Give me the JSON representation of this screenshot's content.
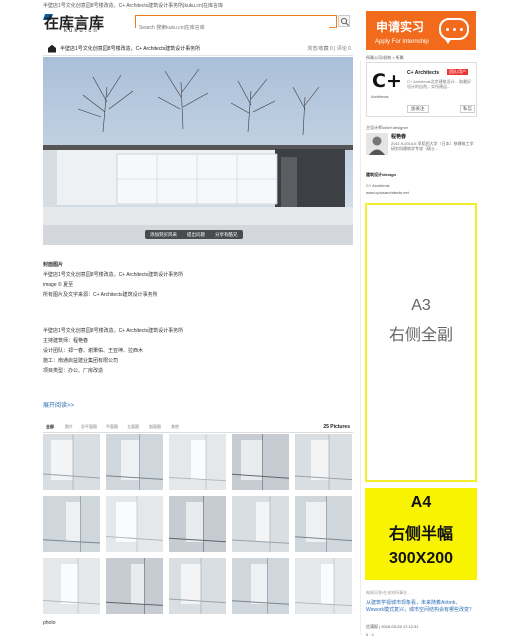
{
  "header": {
    "topline": "半壁店1号文化创意园8号楼改造，C+ Architects建筑设计事务所|kuku.cn|在库言库",
    "logo_main": "在库言库",
    "logo_sub": "kuku.cn",
    "search_placeholder": "Search 搜索kuku.cn|在库言库"
  },
  "apply": {
    "zh": "申请实习",
    "en": "Apply For Internship"
  },
  "article": {
    "title": "半壁店1号文化创意园8号楼改造，C+ Architects建筑设计事务所",
    "stats": "浏览/收藏 0 | 评论 0",
    "hero_buttons": [
      "添加到买风采",
      "提出问题",
      "分享有酷兄"
    ],
    "cover_label": "封面图片",
    "cover_lines": [
      "半壁店1号文化创意园8号楼改造，C+ Architects建筑设计事务所",
      "image © 夏至",
      "所有图片及文字来源：C+ Architects建筑设计事务所"
    ],
    "info_lines": [
      "半壁店1号文化创意园8号楼改造，C+ Architects建筑设计事务所",
      "主持建筑师：程艳春",
      "设计团队：郑一春、谢秉佑、王亚坤、拉西木",
      "施工：南通启益建业集团有限公司",
      "项目类型：办公、厂房改造"
    ],
    "more_link": "展开阅读>>",
    "tabs": [
      "全部",
      "照片",
      "总平面图",
      "平面图",
      "立面图",
      "剖面图",
      "其他"
    ],
    "pictures_count": "25 Pictures",
    "photo_caption": "photo"
  },
  "sidebar": {
    "breadcrumb": "所属公司/机构 > 所属",
    "company_name": "C+ Architects",
    "company_badge": "团队/用户",
    "company_logo_text": "C+",
    "company_logo_sub": "Architects",
    "company_desc": "C+ Architects北京建筑设计... 取最好设计的自然，实所建运...",
    "follow": "加关注",
    "message": "私信",
    "designer_label": "主设计师/chief designer",
    "designer_name": "程艳春",
    "designer_bio": "2011.9-2014.6 早稻田大学（日本）修建筑工学研究科建筑学专攻（硕士...",
    "design_label": "建筑设计/design",
    "design_company": "C+ Architects",
    "design_url": "www.cplusarchitects.net",
    "ad_a3_code": "A3",
    "ad_a3_text": "右侧全副",
    "ad_a4_code": "A4",
    "ad_a4_text": "右侧半幅",
    "ad_a4_size": "300X200",
    "related_label": "每周问答/在未知所事在...",
    "related_title": "从建筑学视城市现象看，未来随着Airbnb、Wework模式复兴，城市空间结构会有哪些改变？",
    "related_meta": "信满报 | 2016-03-25 17:12:31",
    "related_meta2": "0 · 1"
  },
  "colors": {
    "accent": "#f26b1d",
    "link": "#2b6fb6",
    "ad_yellow": "#f8f300",
    "ad_border": "#f4ef2c"
  }
}
